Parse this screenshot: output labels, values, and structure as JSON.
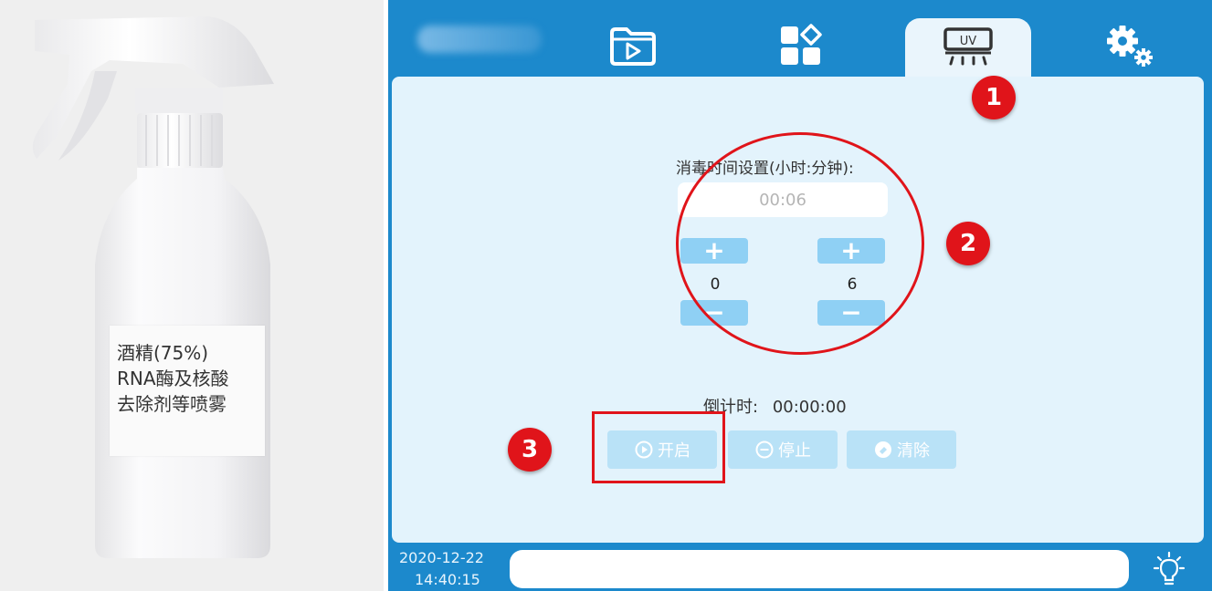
{
  "photo": {
    "label_lines": [
      "酒精(75%)",
      "RNA酶及核酸",
      "去除剂等喷雾"
    ]
  },
  "nav": {
    "tabs": [
      {
        "icon": "video-folder-icon"
      },
      {
        "icon": "apps-grid-icon"
      },
      {
        "icon": "uv-lamp-icon",
        "text": "UV",
        "active": true
      },
      {
        "icon": "settings-gears-icon"
      }
    ]
  },
  "uv": {
    "title": "消毒时间设置(小时:分钟):",
    "time_placeholder": "00:06",
    "hours": "0",
    "minutes": "6",
    "plus": "+",
    "minus": "−",
    "countdown_label": "倒计时:",
    "countdown_value": "00:00:00",
    "buttons": {
      "start": "开启",
      "stop": "停止",
      "clear": "清除"
    }
  },
  "annotations": {
    "badge1": "1",
    "badge2": "2",
    "badge3": "3"
  },
  "footer": {
    "date": "2020-12-22",
    "time": "14:40:15"
  },
  "colors": {
    "header": "#1c89cc",
    "panel": "#e3f3fc",
    "button": "#8fd0f4",
    "annotation": "#e0141a"
  }
}
